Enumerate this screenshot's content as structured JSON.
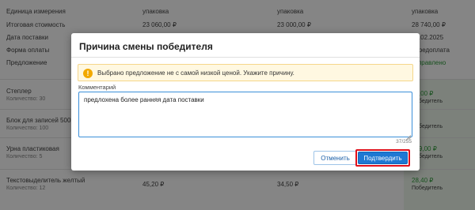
{
  "background": {
    "header_rows": [
      {
        "label": "Единица измерения",
        "c1": "упаковка",
        "c2": "упаковка",
        "c3": "упаковка"
      },
      {
        "label": "Итоговая стоимость",
        "c1": "23 060,00 ₽",
        "c2": "23 000,00 ₽",
        "c3": "28 740,00 ₽"
      },
      {
        "label": "Дата поставки",
        "c1": "",
        "c2": "",
        "c3": "21.02.2025"
      },
      {
        "label": "Форма оплаты",
        "c1": "",
        "c2": "",
        "c3": "/ предоплата"
      },
      {
        "label": "Предложение",
        "c1": "",
        "c2": "",
        "c3": "отправлено"
      }
    ],
    "items": [
      {
        "name": "Степлер",
        "qty": "Количество: 30",
        "c1": "",
        "c2": "",
        "c3": "45,00 ₽",
        "c3_sub": "Победитель"
      },
      {
        "name": "Блок для записей 500 л",
        "qty": "Количество: 100",
        "c1": "",
        "c2": "",
        "c3": "",
        "c3_sub": "Победитель"
      },
      {
        "name": "Урна пластиковая",
        "qty": "Количество: 5",
        "c1": "",
        "c2": "",
        "c3": "319,00 ₽",
        "c3_sub": "Победитель"
      },
      {
        "name": "Текстовыделитель желтый",
        "qty": "Количество: 12",
        "c1": "45,20 ₽",
        "c2": "34,50 ₽",
        "c3": "28,40 ₽",
        "c3_sub": "Победитель"
      }
    ]
  },
  "modal": {
    "title": "Причина смены победителя",
    "warning_icon": "warning-icon",
    "warning_text": "Выбрано предложение не с самой низкой ценой. Укажите причину.",
    "comment_label": "Комментарий",
    "comment_value": "предлохена более ранняя дата поставки",
    "counter": "37/255",
    "cancel_label": "Отменить",
    "confirm_label": "Подтвердить"
  },
  "colors": {
    "accent": "#1e78d3",
    "highlight_border": "#e0101b",
    "warning": "#f2a900",
    "success": "#2e9b3a"
  }
}
